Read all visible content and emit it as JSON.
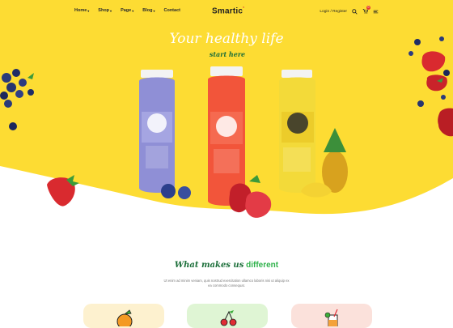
{
  "brand": {
    "name": "Smartic",
    "mark": "°"
  },
  "nav": {
    "items": [
      {
        "label": "Home",
        "has_dropdown": true
      },
      {
        "label": "Shop",
        "has_dropdown": true
      },
      {
        "label": "Page",
        "has_dropdown": true
      },
      {
        "label": "Blog",
        "has_dropdown": true
      },
      {
        "label": "Contact",
        "has_dropdown": false
      }
    ],
    "login_label": "Login / Register",
    "cart_count": "0"
  },
  "hero": {
    "headline": "Your healthy life",
    "subline": "start here"
  },
  "section": {
    "title_script": "What makes us",
    "title_accent": "different",
    "description": "Ut enim ad minim veniam, quis nostrud exercitation ullamco laboris nisi ut aliquip ex ea commodo consequat."
  },
  "colors": {
    "hero_bg": "#fddc33",
    "accent_green": "#2fb24b",
    "dark_green": "#1c6f3a"
  }
}
